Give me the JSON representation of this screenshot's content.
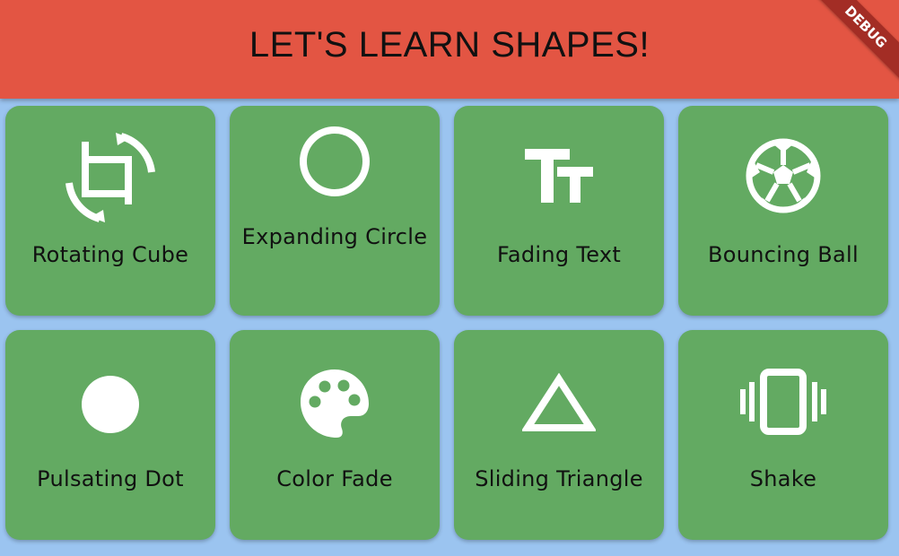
{
  "appbar": {
    "title": "LET'S LEARN SHAPES!",
    "debug_label": "DEBUG",
    "color": "#e35543"
  },
  "theme": {
    "background": "#9bc4f0",
    "card_color": "#63aa62",
    "icon_color": "#ffffff"
  },
  "cards": [
    {
      "label": "Rotating Cube",
      "icon": "crop-rotate-icon"
    },
    {
      "label": "Expanding Circle",
      "icon": "circle-outline-icon"
    },
    {
      "label": "Fading Text",
      "icon": "text-fields-icon"
    },
    {
      "label": "Bouncing Ball",
      "icon": "sports-soccer-icon"
    },
    {
      "label": "Pulsating Dot",
      "icon": "filled-circle-icon"
    },
    {
      "label": "Color Fade",
      "icon": "palette-icon"
    },
    {
      "label": "Sliding Triangle",
      "icon": "triangle-outline-icon"
    },
    {
      "label": "Shake",
      "icon": "vibration-icon"
    }
  ]
}
